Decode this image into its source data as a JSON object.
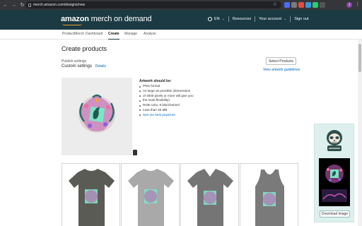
{
  "browser": {
    "url": "merch.amazon.com/designs/new",
    "profile_initial": "J",
    "extension_colors": [
      "#4a6cf7",
      "#7a7a7a",
      "#e74c3c",
      "#3498db",
      "#2ecc71",
      "#555555"
    ]
  },
  "header": {
    "brand_prefix": "amazon",
    "brand_suffix": "merch on demand",
    "language": "EN",
    "resources": "Resources",
    "account": "Your account",
    "sign_out": "Sign out"
  },
  "subnav": {
    "tabs": [
      "ProductMerch",
      "Dashboard",
      "Create",
      "Manage",
      "Analyze"
    ],
    "active_tab": "Create"
  },
  "main": {
    "title": "Create products",
    "publish_label": "Publish settings",
    "custom_settings": "Custom settings",
    "details_link": "Details",
    "select_products": "Select Products",
    "view_guidelines": "View artwork guidelines"
  },
  "requirements": {
    "title": "Artwork should be:",
    "items": [
      "PNG format",
      "As large as possible (dimensions",
      "of 4500 pixels or more will give you",
      "the most flexibility)",
      "RGB color, 8 bits/channel",
      "Less than 25 MB",
      "See our best practices"
    ]
  },
  "preview": {
    "download_label": "Download image"
  },
  "products": [
    {
      "name": "standard-tshirt",
      "color": "#5b5b55"
    },
    {
      "name": "premium-tshirt",
      "color": "#a9a9a9"
    },
    {
      "name": "v-neck-tshirt",
      "color": "#757575"
    },
    {
      "name": "tank-top",
      "color": "#7a7a7a"
    }
  ]
}
